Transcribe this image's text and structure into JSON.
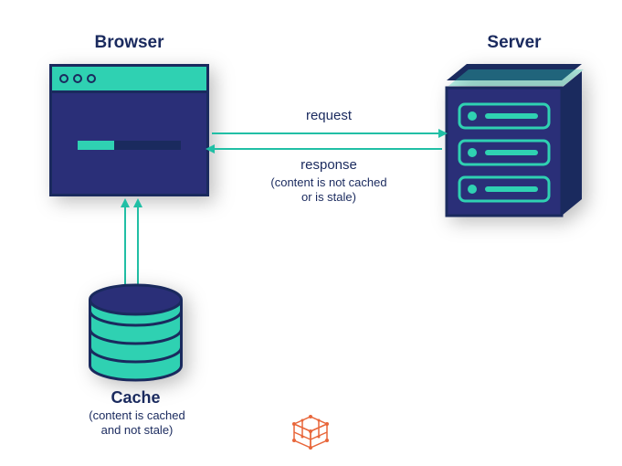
{
  "browser": {
    "title": "Browser"
  },
  "server": {
    "title": "Server"
  },
  "cache": {
    "title": "Cache",
    "subtitle": "(content is cached\nand not stale)"
  },
  "arrows": {
    "request_label": "request",
    "response_label": "response",
    "response_sub": "(content is not cached\nor is stale)"
  },
  "colors": {
    "accent": "#2fd1b2",
    "dark": "#1a2a5e",
    "body": "#2a2f78",
    "orange": "#e8663a"
  }
}
